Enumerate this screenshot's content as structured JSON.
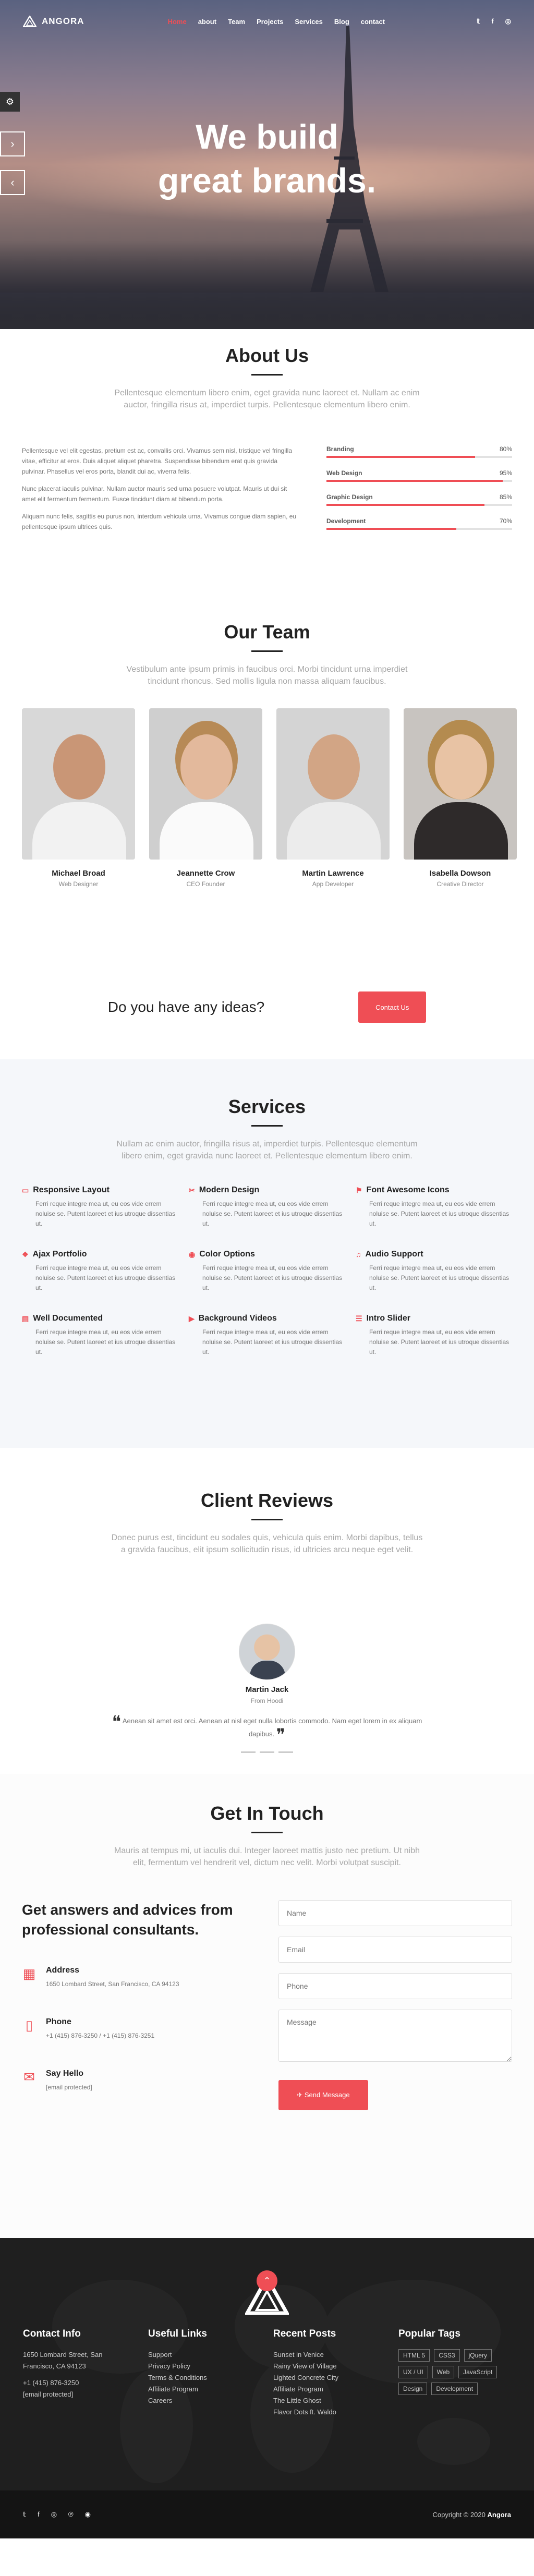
{
  "brand": {
    "name": "ANGORA",
    "accent": "#ef4e55"
  },
  "nav": {
    "items": [
      "Home",
      "about",
      "Team",
      "Projects",
      "Services",
      "Blog",
      "contact"
    ],
    "active": "Home",
    "social": [
      "t",
      "f",
      "in"
    ]
  },
  "hero": {
    "line1": "We build",
    "line2": "great brands."
  },
  "about": {
    "title": "About Us",
    "subtitle": "Pellentesque elementum libero enim, eget gravida nunc laoreet et. Nullam ac enim auctor, fringilla risus at, imperdiet turpis. Pellentesque elementum libero enim.",
    "paragraphs": [
      "Pellentesque vel elit egestas, pretium est ac, convallis orci. Vivamus sem nisl, tristique vel fringilla vitae, efficitur at eros. Duis aliquet aliquet pharetra. Suspendisse bibendum erat quis gravida pulvinar. Phasellus vel eros porta, blandit dui ac, viverra felis.",
      "Nunc placerat iaculis pulvinar. Nullam auctor mauris sed urna posuere volutpat. Mauris ut dui sit amet elit fermentum fermentum. Fusce tincidunt diam at bibendum porta.",
      "Aliquam nunc felis, sagittis eu purus non, interdum vehicula urna. Vivamus congue diam sapien, eu pellentesque ipsum ultrices quis."
    ],
    "skills": [
      {
        "name": "Branding",
        "pct": "80%",
        "value": 0.8
      },
      {
        "name": "Web Design",
        "pct": "95%",
        "value": 0.95
      },
      {
        "name": "Graphic Design",
        "pct": "85%",
        "value": 0.85
      },
      {
        "name": "Development",
        "pct": "70%",
        "value": 0.7
      }
    ]
  },
  "team": {
    "title": "Our Team",
    "subtitle": "Vestibulum ante ipsum primis in faucibus orci. Morbi tincidunt urna imperdiet tincidunt rhoncus. Sed mollis ligula non massa aliquam faucibus.",
    "members": [
      {
        "name": "Michael Broad",
        "role": "Web Designer"
      },
      {
        "name": "Jeannette Crow",
        "role": "CEO Founder"
      },
      {
        "name": "Martin Lawrence",
        "role": "App Developer"
      },
      {
        "name": "Isabella Dowson",
        "role": "Creative Director"
      }
    ]
  },
  "cta": {
    "question": "Do you have any ideas?",
    "button": "Contact Us"
  },
  "services": {
    "title": "Services",
    "subtitle": "Nullam ac enim auctor, fringilla risus at, imperdiet turpis. Pellentesque elementum libero enim, eget gravida nunc laoreet et. Pellentesque elementum libero enim.",
    "desc": "Ferri reque integre mea ut, eu eos vide errem noluise se. Putent laoreet et ius utroque dissentias ut.",
    "items": [
      {
        "name": "Responsive Layout",
        "icon": "monitor-icon"
      },
      {
        "name": "Modern Design",
        "icon": "scissors-icon"
      },
      {
        "name": "Font Awesome Icons",
        "icon": "flag-icon"
      },
      {
        "name": "Ajax Portfolio",
        "icon": "cubes-icon"
      },
      {
        "name": "Color Options",
        "icon": "eye-icon"
      },
      {
        "name": "Audio Support",
        "icon": "music-icon"
      },
      {
        "name": "Well Documented",
        "icon": "book-icon"
      },
      {
        "name": "Background Videos",
        "icon": "video-icon"
      },
      {
        "name": "Intro Slider",
        "icon": "sliders-icon"
      }
    ]
  },
  "reviews": {
    "title": "Client Reviews",
    "subtitle": "Donec purus est, tincidunt eu sodales quis, vehicula quis enim. Morbi dapibus, tellus a gravida faucibus, elit ipsum sollicitudin risus, id ultricies arcu neque eget velit.",
    "name": "Martin Jack",
    "from": "From Hoodi",
    "text": "Aenean sit amet est orci. Aenean at nisl eget nulla lobortis commodo. Nam eget lorem in ex aliquam dapibus."
  },
  "contact": {
    "title": "Get In Touch",
    "subtitle": "Mauris at tempus mi, ut iaculis dui. Integer laoreet mattis justo nec pretium. Ut nibh elit, fermentum vel hendrerit vel, dictum nec velit. Morbi volutpat suscipit.",
    "heading": "Get answers and advices from professional consultants.",
    "address_label": "Address",
    "address": "1650 Lombard Street, San Francisco, CA 94123",
    "phone_label": "Phone",
    "phone": "+1 (415) 876-3250 / +1 (415) 876-3251",
    "email_label": "Say Hello",
    "email": "[email protected]",
    "form": {
      "name": "Name",
      "email": "Email",
      "phone": "Phone",
      "message": "Message",
      "send": "Send Message"
    }
  },
  "footer": {
    "contact": {
      "title": "Contact Info",
      "address": "1650 Lombard Street, San Francisco, CA 94123",
      "phone": "+1 (415) 876-3250",
      "email": "[email protected]"
    },
    "links": {
      "title": "Useful Links",
      "items": [
        "Support",
        "Privacy Policy",
        "Terms & Conditions",
        "Affiliate Program",
        "Careers"
      ]
    },
    "posts": {
      "title": "Recent Posts",
      "items": [
        "Sunset in Venice",
        "Rainy View of Village",
        "Lighted Concrete City",
        "Affiliate Program",
        "The Little Ghost",
        "Flavor Dots ft. Waldo"
      ]
    },
    "tags": {
      "title": "Popular Tags",
      "items": [
        "HTML 5",
        "CSS3",
        "jQuery",
        "UX / UI",
        "Web",
        "JavaScript",
        "Design",
        "Development"
      ]
    },
    "social": [
      "t",
      "f",
      "ig",
      "p",
      "d"
    ],
    "copyright": "Copyright © 2020",
    "brand": "Angora"
  }
}
